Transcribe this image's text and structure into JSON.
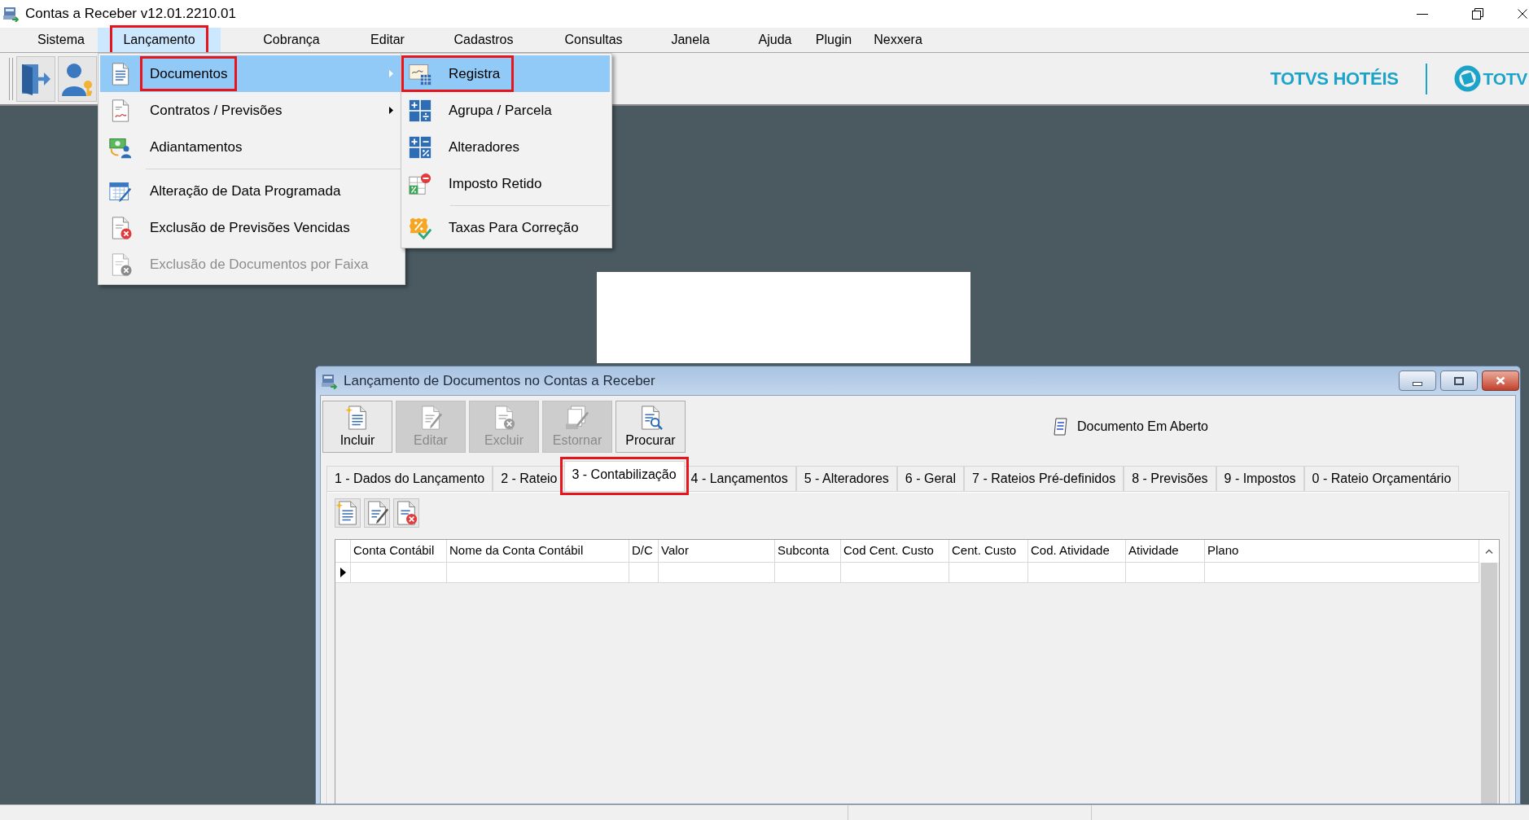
{
  "window": {
    "title": "Contas a Receber v12.01.2210.01"
  },
  "menubar": [
    {
      "label": "Sistema",
      "selected": false,
      "framed": false
    },
    {
      "label": "Lançamento",
      "selected": true,
      "framed": true
    },
    {
      "label": "Cobrança",
      "selected": false,
      "framed": false
    },
    {
      "label": "Editar",
      "selected": false,
      "framed": false
    },
    {
      "label": "Cadastros",
      "selected": false,
      "framed": false
    },
    {
      "label": "Consultas",
      "selected": false,
      "framed": false
    },
    {
      "label": "Janela",
      "selected": false,
      "framed": false
    },
    {
      "label": "Ajuda",
      "selected": false,
      "framed": false
    },
    {
      "label": "Plugin",
      "selected": false,
      "framed": false
    },
    {
      "label": "Nexxera",
      "selected": false,
      "framed": false
    }
  ],
  "brand": {
    "product": "TOTVS HOTÉIS",
    "company": "TOTV"
  },
  "menu": {
    "items": [
      {
        "kind": "item",
        "label": "Documentos",
        "selected": true,
        "framed": true,
        "disabled": false,
        "submenu": true
      },
      {
        "kind": "item",
        "label": "Contratos / Previsões",
        "selected": false,
        "framed": false,
        "disabled": false,
        "submenu": true
      },
      {
        "kind": "item",
        "label": "Adiantamentos",
        "selected": false,
        "framed": false,
        "disabled": false,
        "submenu": false
      },
      {
        "kind": "separator"
      },
      {
        "kind": "item",
        "label": "Alteração de Data Programada",
        "selected": false,
        "framed": false,
        "disabled": false,
        "submenu": false
      },
      {
        "kind": "item",
        "label": "Exclusão de Previsões Vencidas",
        "selected": false,
        "framed": false,
        "disabled": false,
        "submenu": false
      },
      {
        "kind": "item",
        "label": "Exclusão de Documentos por Faixa",
        "selected": false,
        "framed": false,
        "disabled": true,
        "submenu": false
      }
    ]
  },
  "submenu": {
    "items": [
      {
        "kind": "item",
        "label": "Registra",
        "selected": true,
        "framed": true,
        "disabled": false,
        "submenu": false
      },
      {
        "kind": "item",
        "label": "Agrupa / Parcela",
        "selected": false,
        "framed": false,
        "disabled": false,
        "submenu": false
      },
      {
        "kind": "item",
        "label": "Alteradores",
        "selected": false,
        "framed": false,
        "disabled": false,
        "submenu": false
      },
      {
        "kind": "item",
        "label": "Imposto Retido",
        "selected": false,
        "framed": false,
        "disabled": false,
        "submenu": false
      },
      {
        "kind": "separator"
      },
      {
        "kind": "item",
        "label": "Taxas Para Correção",
        "selected": false,
        "framed": false,
        "disabled": false,
        "submenu": false
      }
    ]
  },
  "document_window": {
    "title": "Lançamento de Documentos no Contas a Receber",
    "actions": [
      {
        "label": "Incluir",
        "disabled": false
      },
      {
        "label": "Editar",
        "disabled": true
      },
      {
        "label": "Excluir",
        "disabled": true
      },
      {
        "label": "Estornar",
        "disabled": true
      },
      {
        "label": "Procurar",
        "disabled": false
      }
    ],
    "status": "Documento Em Aberto",
    "tabs": [
      {
        "label": "1 - Dados do Lançamento",
        "selected": false,
        "framed": false
      },
      {
        "label": "2 - Rateio",
        "selected": false,
        "framed": false
      },
      {
        "label": "3 - Contabilização",
        "selected": true,
        "framed": true
      },
      {
        "label": "4 - Lançamentos",
        "selected": false,
        "framed": false
      },
      {
        "label": "5 - Alteradores",
        "selected": false,
        "framed": false
      },
      {
        "label": "6 - Geral",
        "selected": false,
        "framed": false
      },
      {
        "label": "7 - Rateios Pré-definidos",
        "selected": false,
        "framed": false
      },
      {
        "label": "8 - Previsões",
        "selected": false,
        "framed": false
      },
      {
        "label": "9 - Impostos",
        "selected": false,
        "framed": false
      },
      {
        "label": "0 - Rateio Orçamentário",
        "selected": false,
        "framed": false
      }
    ],
    "grid": {
      "columns": [
        "Conta Contábil",
        "Nome da Conta Contábil",
        "D/C",
        "Valor",
        "Subconta",
        "Cod Cent. Custo",
        "Cent. Custo",
        "Cod. Atividade",
        "Atividade",
        "Plano"
      ],
      "rows": [
        {
          "current": true
        }
      ]
    }
  }
}
